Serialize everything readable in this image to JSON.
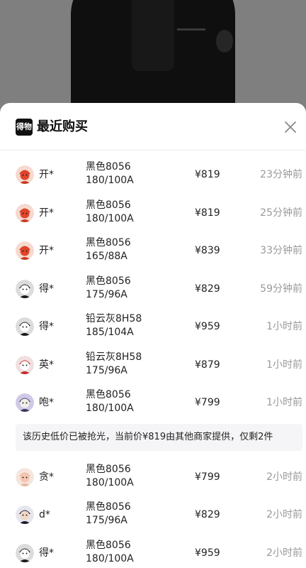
{
  "sheet": {
    "brand_logo_text": "得物",
    "title": "最近购买",
    "close_icon": "close-icon"
  },
  "purchases_before_notice": [
    {
      "user": "开*",
      "color": "黑色8056",
      "size": "180/100A",
      "price": "¥819",
      "time": "23分钟前",
      "avatar": "red"
    },
    {
      "user": "开*",
      "color": "黑色8056",
      "size": "180/100A",
      "price": "¥819",
      "time": "25分钟前",
      "avatar": "red"
    },
    {
      "user": "开*",
      "color": "黑色8056",
      "size": "165/88A",
      "price": "¥839",
      "time": "33分钟前",
      "avatar": "red"
    },
    {
      "user": "得*",
      "color": "黑色8056",
      "size": "175/96A",
      "price": "¥829",
      "time": "59分钟前",
      "avatar": "bw"
    },
    {
      "user": "得*",
      "color": "铅云灰8H58",
      "size": "185/104A",
      "price": "¥959",
      "time": "1小时前",
      "avatar": "bw"
    },
    {
      "user": "英*",
      "color": "铅云灰8H58",
      "size": "175/96A",
      "price": "¥879",
      "time": "1小时前",
      "avatar": "redwhite"
    },
    {
      "user": "咆*",
      "color": "黑色8056",
      "size": "180/100A",
      "price": "¥799",
      "time": "1小时前",
      "avatar": "purple"
    }
  ],
  "notice": "该历史低价已被抢光，当前价¥819由其他商家提供，仅剩2件",
  "purchases_after_notice": [
    {
      "user": "贪*",
      "color": "黑色8056",
      "size": "180/100A",
      "price": "¥799",
      "time": "2小时前",
      "avatar": "peach"
    },
    {
      "user": "d*",
      "color": "黑色8056",
      "size": "175/96A",
      "price": "¥829",
      "time": "2小时前",
      "avatar": "dark"
    },
    {
      "user": "得*",
      "color": "黑色8056",
      "size": "180/100A",
      "price": "¥959",
      "time": "2小时前",
      "avatar": "bw"
    }
  ]
}
